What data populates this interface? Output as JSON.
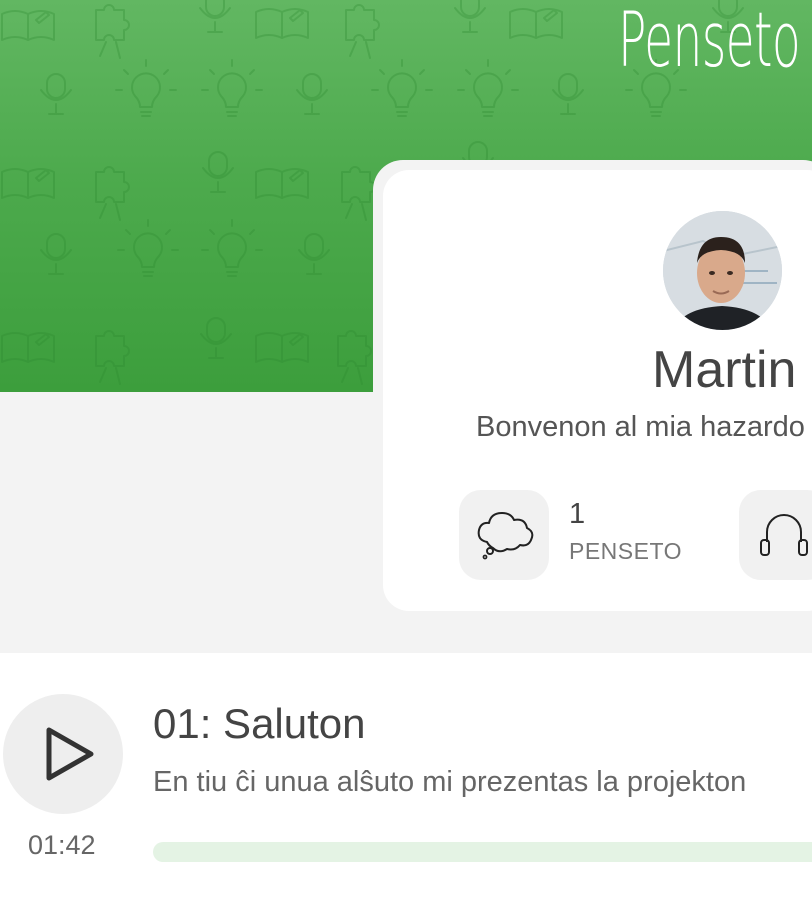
{
  "header": {
    "brand": "Penseto",
    "brand_color": "#4caf50"
  },
  "profile": {
    "name": "Martin",
    "bio": "Bonvenon al mia hazardo",
    "avatar": "avatar-photo",
    "stats": [
      {
        "count": "1",
        "label": "PENSETO",
        "icon": "thought-bubble-icon"
      },
      {
        "icon": "headphones-icon"
      }
    ]
  },
  "episode": {
    "title": "01: Saluton",
    "description": "En tiu ĉi unua alŝuto mi prezentas la projekton",
    "duration": "01:42",
    "play_icon": "play-icon",
    "progress_fraction": 0
  }
}
